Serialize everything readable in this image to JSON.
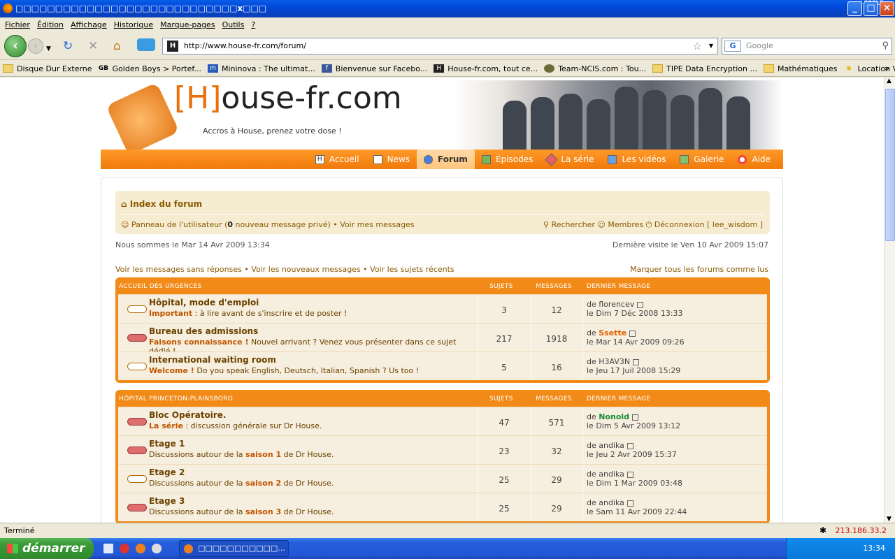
{
  "window": {
    "title": "□□□□□□□□□□□□□□□□□□□□□□□□□□□□x□□□",
    "speed": "↓228kB"
  },
  "menu": [
    "Fichier",
    "Édition",
    "Affichage",
    "Historique",
    "Marque-pages",
    "Outils",
    "?"
  ],
  "url": "http://www.house-fr.com/forum/",
  "search_placeholder": "Google",
  "bookmarks": [
    "Disque Dur Externe",
    "Golden Boys > Portef...",
    "Mininova : The ultimat...",
    "Bienvenue sur Facebo...",
    "House-fr.com, tout ce...",
    "Team-NCIS.com : Tou...",
    "TIPE Data Encryption ...",
    "Mathématiques",
    "Location Villa Cuers"
  ],
  "site": {
    "logo_bracket": "[H]",
    "logo_rest": "ouse-fr.com",
    "slogan": "Accros à House, prenez votre dose !"
  },
  "nav": [
    "Accueil",
    "News",
    "Forum",
    "Épisodes",
    "La série",
    "Les vidéos",
    "Galerie",
    "Aide"
  ],
  "nav_active": "Forum",
  "navbar": {
    "index": "Index du forum",
    "ucp": "Panneau de l'utilisateur (",
    "pm_count": "0",
    "pm_text": " nouveau message privé)",
    "my_msgs": "Voir mes messages",
    "search": "Rechercher",
    "members": "Membres",
    "logout": "Déconnexion [ lee_wisdom ]"
  },
  "now": "Nous sommes le Mar 14 Avr 2009 13:34",
  "last_visit": "Dernière visite le Ven 10 Avr 2009 15:07",
  "links": {
    "unanswered": "Voir les messages sans réponses",
    "new": "Voir les nouveaux messages",
    "recent": "Voir les sujets récents",
    "mark": "Marquer tous les forums comme lus"
  },
  "cols": {
    "topics": "SUJETS",
    "posts": "MESSAGES",
    "last": "DERNIER MESSAGE"
  },
  "categories": [
    {
      "name": "ACCUEIL DES URGENCES",
      "forums": [
        {
          "title": "Hôpital, mode d'emploi",
          "bold": "Important",
          "desc": " : à lire avant de s'inscrire et de poster !",
          "topics": "3",
          "posts": "12",
          "by": "florencev",
          "date": "le Dim 7 Déc 2008 13:33",
          "new": false
        },
        {
          "title": "Bureau des admissions",
          "bold": "Faisons connaissance !",
          "desc": " Nouvel arrivant ? Venez vous présenter dans ce sujet dédié !",
          "topics": "217",
          "posts": "1918",
          "by": "Ssette",
          "date": "le Mar 14 Avr 2009 09:26",
          "new": true
        },
        {
          "title": "International waiting room",
          "bold": "Welcome !",
          "desc": " Do you speak English, Deutsch, Italian, Spanish ? Us too !",
          "topics": "5",
          "posts": "16",
          "by": "H3AV3N",
          "date": "le Jeu 17 Juil 2008 15:29",
          "new": false
        }
      ]
    },
    {
      "name": "HÔPITAL PRINCETON-PLAINSBORO",
      "forums": [
        {
          "title": "Bloc Opératoire.",
          "bold": "La série",
          "desc": " : discussion générale sur Dr House.",
          "topics": "47",
          "posts": "571",
          "by": "Nonold",
          "date": "le Dim 5 Avr 2009 13:12",
          "new": true
        },
        {
          "title": "Etage 1",
          "pre": "Discussions autour de la ",
          "bold": "saison 1",
          "desc": " de Dr House.",
          "topics": "23",
          "posts": "32",
          "by": "andika",
          "date": "le Jeu 2 Avr 2009 15:37",
          "new": true
        },
        {
          "title": "Etage 2",
          "pre": "Discussions autour de la ",
          "bold": "saison 2",
          "desc": " de Dr House.",
          "topics": "25",
          "posts": "29",
          "by": "andika",
          "date": "le Dim 1 Mar 2009 03:48",
          "new": false
        },
        {
          "title": "Etage 3",
          "pre": "Discussions autour de la ",
          "bold": "saison 3",
          "desc": " de Dr House.",
          "topics": "25",
          "posts": "29",
          "by": "andika",
          "date": "le Sam 11 Avr 2009 22:44",
          "new": true
        }
      ]
    }
  ],
  "status": {
    "text": "Terminé",
    "ip": "213.186.33.2"
  },
  "taskbar": {
    "start": "démarrer",
    "task": "□□□□□□□□□□□...",
    "clock": "13:34"
  },
  "colors": {
    "accent": "#f28a18",
    "link": "#8a5a00",
    "titlebar": "#0048d8"
  }
}
